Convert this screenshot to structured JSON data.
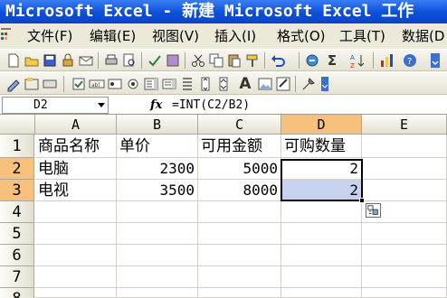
{
  "window": {
    "title": "Microsoft Excel - 新建 Microsoft Excel 工作"
  },
  "menu": [
    {
      "label": "文件(F)"
    },
    {
      "label": "编辑(E)"
    },
    {
      "label": "视图(V)"
    },
    {
      "label": "插入(I)"
    },
    {
      "label": "格式(O)"
    },
    {
      "label": "工具(T)"
    },
    {
      "label": "数据(D"
    }
  ],
  "toolbar_icons": {
    "standard": [
      "new-icon",
      "open-icon",
      "save-icon",
      "permission-icon",
      "email-icon",
      "print-icon",
      "print-preview-icon",
      "spelling-icon",
      "research-icon",
      "cut-icon",
      "copy-icon",
      "paste-icon",
      "format-painter-icon",
      "undo-icon",
      "hyperlink-icon",
      "autosum-icon",
      "sort-ascending-icon",
      "chart-wizard-icon",
      "help-icon"
    ],
    "forms": [
      "label-icon",
      "groupbox-icon",
      "button-icon",
      "checkbox-icon",
      "textbox-icon",
      "radio-icon",
      "listbox-icon",
      "combobox-icon",
      "scrollbar-icon",
      "spinner-icon",
      "text-icon",
      "image-icon",
      "properties-icon"
    ]
  },
  "toolbar_glyphs": {
    "autosum": "Σ",
    "text": "A"
  },
  "formula_bar": {
    "name_box": "D2",
    "fx_label": "fx",
    "formula": "=INT(C2/B2)"
  },
  "columns": [
    "A",
    "B",
    "C",
    "D",
    "E"
  ],
  "rows": [
    "1",
    "2",
    "3",
    "4",
    "5",
    "6",
    "7",
    "8"
  ],
  "cells": {
    "A1": "商品名称",
    "B1": "单价",
    "C1": "可用金额",
    "D1": "可购数量",
    "A2": "电脑",
    "B2": "2300",
    "C2": "5000",
    "D2": "2",
    "A3": "电视",
    "B3": "3500",
    "C3": "8000",
    "D3": "2"
  },
  "selection": {
    "range": "D2:D3",
    "active": "D2"
  },
  "colors": {
    "title_bar": "#0a4fd8",
    "menu_bg": "#ece9d8",
    "header_selected": "#f7c07c",
    "selected_cell": "#c7d3ee"
  }
}
